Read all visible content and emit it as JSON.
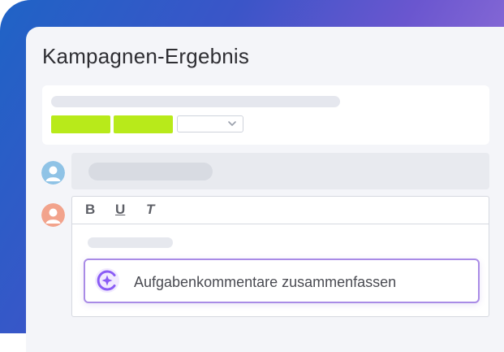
{
  "page": {
    "title": "Kampagnen-Ergebnis"
  },
  "colors": {
    "tag_green": "#b8ea1a",
    "ai_accent": "#8a5cf5",
    "avatar_blue": "#8fc3e6",
    "avatar_orange": "#f2a38c"
  },
  "editor": {
    "toolbar": {
      "bold": "B",
      "underline": "U",
      "italic": "T"
    },
    "ai_action": {
      "label": "Aufgabenkommentare zusammenfassen",
      "icon": "ai-sparkle-icon"
    }
  }
}
